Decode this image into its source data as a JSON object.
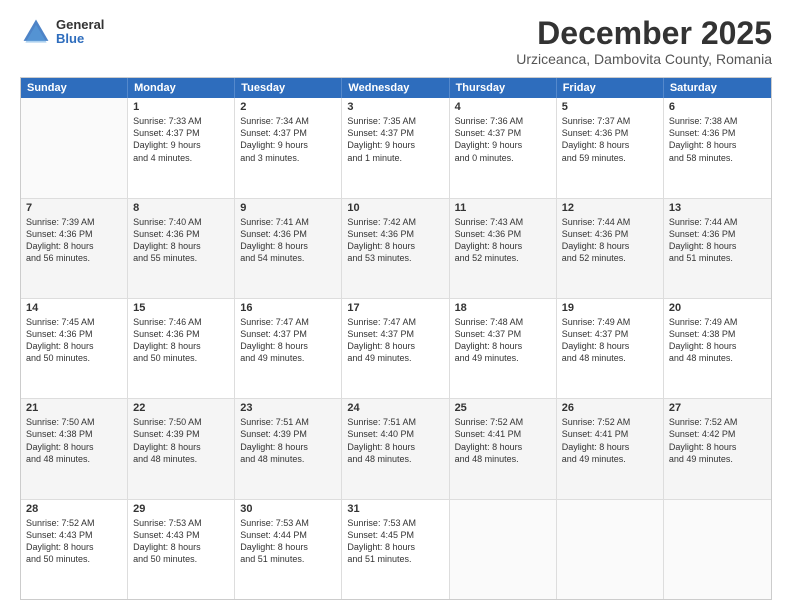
{
  "logo": {
    "general": "General",
    "blue": "Blue"
  },
  "header": {
    "title": "December 2025",
    "subtitle": "Urziceanca, Dambovita County, Romania"
  },
  "calendar": {
    "days": [
      "Sunday",
      "Monday",
      "Tuesday",
      "Wednesday",
      "Thursday",
      "Friday",
      "Saturday"
    ],
    "weeks": [
      [
        {
          "day": "",
          "content": ""
        },
        {
          "day": "1",
          "content": "Sunrise: 7:33 AM\nSunset: 4:37 PM\nDaylight: 9 hours\nand 4 minutes."
        },
        {
          "day": "2",
          "content": "Sunrise: 7:34 AM\nSunset: 4:37 PM\nDaylight: 9 hours\nand 3 minutes."
        },
        {
          "day": "3",
          "content": "Sunrise: 7:35 AM\nSunset: 4:37 PM\nDaylight: 9 hours\nand 1 minute."
        },
        {
          "day": "4",
          "content": "Sunrise: 7:36 AM\nSunset: 4:37 PM\nDaylight: 9 hours\nand 0 minutes."
        },
        {
          "day": "5",
          "content": "Sunrise: 7:37 AM\nSunset: 4:36 PM\nDaylight: 8 hours\nand 59 minutes."
        },
        {
          "day": "6",
          "content": "Sunrise: 7:38 AM\nSunset: 4:36 PM\nDaylight: 8 hours\nand 58 minutes."
        }
      ],
      [
        {
          "day": "7",
          "content": "Sunrise: 7:39 AM\nSunset: 4:36 PM\nDaylight: 8 hours\nand 56 minutes."
        },
        {
          "day": "8",
          "content": "Sunrise: 7:40 AM\nSunset: 4:36 PM\nDaylight: 8 hours\nand 55 minutes."
        },
        {
          "day": "9",
          "content": "Sunrise: 7:41 AM\nSunset: 4:36 PM\nDaylight: 8 hours\nand 54 minutes."
        },
        {
          "day": "10",
          "content": "Sunrise: 7:42 AM\nSunset: 4:36 PM\nDaylight: 8 hours\nand 53 minutes."
        },
        {
          "day": "11",
          "content": "Sunrise: 7:43 AM\nSunset: 4:36 PM\nDaylight: 8 hours\nand 52 minutes."
        },
        {
          "day": "12",
          "content": "Sunrise: 7:44 AM\nSunset: 4:36 PM\nDaylight: 8 hours\nand 52 minutes."
        },
        {
          "day": "13",
          "content": "Sunrise: 7:44 AM\nSunset: 4:36 PM\nDaylight: 8 hours\nand 51 minutes."
        }
      ],
      [
        {
          "day": "14",
          "content": "Sunrise: 7:45 AM\nSunset: 4:36 PM\nDaylight: 8 hours\nand 50 minutes."
        },
        {
          "day": "15",
          "content": "Sunrise: 7:46 AM\nSunset: 4:36 PM\nDaylight: 8 hours\nand 50 minutes."
        },
        {
          "day": "16",
          "content": "Sunrise: 7:47 AM\nSunset: 4:37 PM\nDaylight: 8 hours\nand 49 minutes."
        },
        {
          "day": "17",
          "content": "Sunrise: 7:47 AM\nSunset: 4:37 PM\nDaylight: 8 hours\nand 49 minutes."
        },
        {
          "day": "18",
          "content": "Sunrise: 7:48 AM\nSunset: 4:37 PM\nDaylight: 8 hours\nand 49 minutes."
        },
        {
          "day": "19",
          "content": "Sunrise: 7:49 AM\nSunset: 4:37 PM\nDaylight: 8 hours\nand 48 minutes."
        },
        {
          "day": "20",
          "content": "Sunrise: 7:49 AM\nSunset: 4:38 PM\nDaylight: 8 hours\nand 48 minutes."
        }
      ],
      [
        {
          "day": "21",
          "content": "Sunrise: 7:50 AM\nSunset: 4:38 PM\nDaylight: 8 hours\nand 48 minutes."
        },
        {
          "day": "22",
          "content": "Sunrise: 7:50 AM\nSunset: 4:39 PM\nDaylight: 8 hours\nand 48 minutes."
        },
        {
          "day": "23",
          "content": "Sunrise: 7:51 AM\nSunset: 4:39 PM\nDaylight: 8 hours\nand 48 minutes."
        },
        {
          "day": "24",
          "content": "Sunrise: 7:51 AM\nSunset: 4:40 PM\nDaylight: 8 hours\nand 48 minutes."
        },
        {
          "day": "25",
          "content": "Sunrise: 7:52 AM\nSunset: 4:41 PM\nDaylight: 8 hours\nand 48 minutes."
        },
        {
          "day": "26",
          "content": "Sunrise: 7:52 AM\nSunset: 4:41 PM\nDaylight: 8 hours\nand 49 minutes."
        },
        {
          "day": "27",
          "content": "Sunrise: 7:52 AM\nSunset: 4:42 PM\nDaylight: 8 hours\nand 49 minutes."
        }
      ],
      [
        {
          "day": "28",
          "content": "Sunrise: 7:52 AM\nSunset: 4:43 PM\nDaylight: 8 hours\nand 50 minutes."
        },
        {
          "day": "29",
          "content": "Sunrise: 7:53 AM\nSunset: 4:43 PM\nDaylight: 8 hours\nand 50 minutes."
        },
        {
          "day": "30",
          "content": "Sunrise: 7:53 AM\nSunset: 4:44 PM\nDaylight: 8 hours\nand 51 minutes."
        },
        {
          "day": "31",
          "content": "Sunrise: 7:53 AM\nSunset: 4:45 PM\nDaylight: 8 hours\nand 51 minutes."
        },
        {
          "day": "",
          "content": ""
        },
        {
          "day": "",
          "content": ""
        },
        {
          "day": "",
          "content": ""
        }
      ]
    ]
  }
}
